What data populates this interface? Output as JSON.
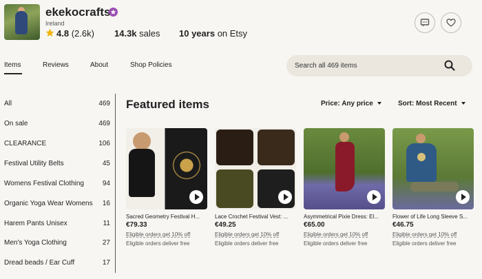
{
  "shop": {
    "name": "ekekocrafts",
    "location": "Ireland",
    "rating": "4.8",
    "rating_count": "(2.6k)",
    "sales_count": "14.3k",
    "sales_label": "sales",
    "years_count": "10 years",
    "years_label": "on Etsy"
  },
  "tabs": [
    {
      "label": "Items"
    },
    {
      "label": "Reviews"
    },
    {
      "label": "About"
    },
    {
      "label": "Shop Policies"
    }
  ],
  "search": {
    "placeholder": "Search all 469 items"
  },
  "sidebar": {
    "items": [
      {
        "label": "All",
        "count": "469"
      },
      {
        "label": "On sale",
        "count": "469"
      },
      {
        "label": "CLEARANCE",
        "count": "106"
      },
      {
        "label": "Festival Utility Belts",
        "count": "45"
      },
      {
        "label": "Womens Festival Clothing",
        "count": "94"
      },
      {
        "label": "Organic Yoga Wear Womens",
        "count": "16"
      },
      {
        "label": "Harem Pants Unisex",
        "count": "11"
      },
      {
        "label": "Men's Yoga Clothing",
        "count": "27"
      },
      {
        "label": "Dread beads / Ear Cuff",
        "count": "17"
      }
    ]
  },
  "main": {
    "heading": "Featured items",
    "price_filter": "Price: Any price",
    "sort": "Sort: Most Recent"
  },
  "products": [
    {
      "title": "Sacred Geometry Festival H...",
      "price": "€79.33",
      "promo": "Eligible orders get 10% off",
      "shipping": "Eligible orders deliver free"
    },
    {
      "title": "Lace Crochet Festival Vest: ...",
      "price": "€49.25",
      "promo": "Eligible orders get 10% off",
      "shipping": "Eligible orders deliver free"
    },
    {
      "title": "Asymmetrical Pixie Dress: El...",
      "price": "€65.00",
      "promo": "Eligible orders get 10% off",
      "shipping": "Eligible orders deliver free"
    },
    {
      "title": "Flower of Life Long Sleeve S...",
      "price": "€46.75",
      "promo": "Eligible orders get 10% off",
      "shipping": "Eligible orders deliver free"
    }
  ],
  "colors": {
    "accent": "#9b4fb0",
    "star": "#f1b400",
    "background": "#f7f6f3"
  }
}
